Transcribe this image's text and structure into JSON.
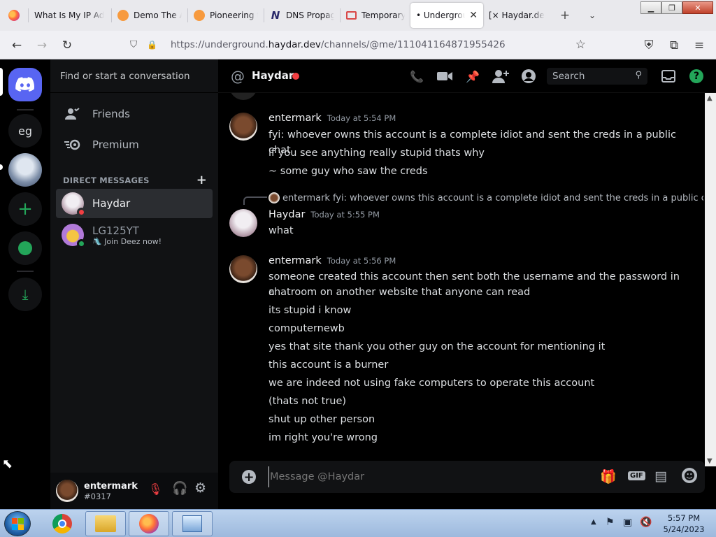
{
  "browser": {
    "tabs": [
      {
        "title": "What Is My IP Ad",
        "icon": "firefox-icon"
      },
      {
        "title": "Demo The Ai",
        "icon": "sunset-icon"
      },
      {
        "title": "Pioneering the",
        "icon": "sunset-icon"
      },
      {
        "title": "DNS Propaga",
        "icon": "n-icon"
      },
      {
        "title": "Temporary E",
        "icon": "mail-icon"
      },
      {
        "title": "• Underground",
        "icon": "",
        "active": true
      },
      {
        "title": "[× Haydar.dev ×",
        "icon": ""
      }
    ],
    "url_prefix": "https://underground.",
    "url_host": "haydar.dev",
    "url_path": "/channels/@me/1110411648719554​26",
    "url_full": "https://underground.haydar.dev/channels/@me/1110411648719554 26"
  },
  "sidebar": {
    "search_placeholder": "Find or start a conversation",
    "friends": "Friends",
    "premium": "Premium",
    "dm_header": "DIRECT MESSAGES",
    "dms": [
      {
        "name": "Haydar",
        "status": "dnd",
        "active": true
      },
      {
        "name": "LG125YT",
        "status": "online",
        "sub": "🛝 Join Deez now!"
      }
    ]
  },
  "guilds": {
    "text_server": "eg"
  },
  "user": {
    "name": "entermark",
    "tag": "#0317"
  },
  "header": {
    "channel_name": "Haydar",
    "search": "Search"
  },
  "messages": [
    {
      "author": "entermark",
      "time": "Today at 5:54 PM",
      "lines": [
        "fyi: whoever owns this account is a complete idiot and sent the creds in a public chat",
        "if you see anything really stupid thats why",
        "~ some guy who saw the creds"
      ]
    },
    {
      "reply_author": "entermark",
      "reply_text": "fyi: whoever owns this account is a complete idiot and sent the creds in a public ch",
      "author": "Haydar",
      "time": "Today at 5:55 PM",
      "lines": [
        "what"
      ]
    },
    {
      "author": "entermark",
      "time": "Today at 5:56 PM",
      "lines": [
        "someone created this account then sent both the username and the password in a",
        "chatroom on another website that anyone can read",
        "its stupid i know",
        "computernewb",
        "yes that site thank you other guy on the account for mentioning it",
        "this account is a burner",
        "we are indeed not using fake computers to operate this account",
        "(thats not true)",
        "shut up other person",
        "im right you're wrong"
      ]
    }
  ],
  "composer": {
    "placeholder": "Message @Haydar",
    "gif_label": "GIF"
  },
  "taskbar": {
    "time": "5:57 PM",
    "date": "5/24/2023"
  },
  "colors": {
    "blurple": "#5865f2",
    "green": "#23a559",
    "dnd": "#f23f43",
    "background": "#000000"
  }
}
